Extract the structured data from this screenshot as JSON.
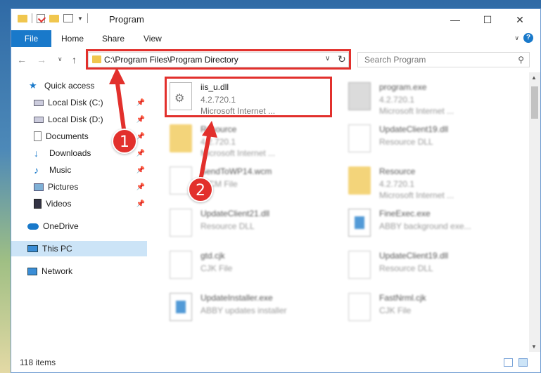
{
  "window": {
    "title": "Program"
  },
  "ribbon": {
    "tabs": [
      "File",
      "Home",
      "Share",
      "View"
    ],
    "help": "?"
  },
  "address": {
    "path": "C:\\Program Files\\Program Directory",
    "search_placeholder": "Search Program"
  },
  "sidebar": {
    "items": [
      {
        "label": "Quick access",
        "icon": "star-icon"
      },
      {
        "label": "Local Disk (C:)",
        "icon": "drive-icon",
        "pinned": true
      },
      {
        "label": "Local Disk (D:)",
        "icon": "drive-icon",
        "pinned": true
      },
      {
        "label": "Documents",
        "icon": "documents-icon",
        "pinned": true
      },
      {
        "label": "Downloads",
        "icon": "downloads-icon",
        "pinned": true
      },
      {
        "label": "Music",
        "icon": "music-icon",
        "pinned": true
      },
      {
        "label": "Pictures",
        "icon": "pictures-icon",
        "pinned": true
      },
      {
        "label": "Videos",
        "icon": "videos-icon",
        "pinned": true
      },
      {
        "label": "OneDrive",
        "icon": "cloud-icon"
      },
      {
        "label": "This PC",
        "icon": "computer-icon",
        "selected": true
      },
      {
        "label": "Network",
        "icon": "network-icon"
      }
    ]
  },
  "files": [
    {
      "name": "iis_u.dll",
      "line2": "4.2.720.1",
      "line3": "Microsoft Internet ...",
      "icon": "dll-icon"
    },
    {
      "name": "program.exe",
      "line2": "4.2.720.1",
      "line3": "Microsoft Internet ...",
      "icon": "exe-icon"
    },
    {
      "name": "Resource",
      "line2": "4.2.720.1",
      "line3": "Microsoft Internet ...",
      "icon": "folder-icon"
    },
    {
      "name": "UpdateClient19.dll",
      "line2": "Resource DLL",
      "line3": "",
      "icon": "dll-icon"
    },
    {
      "name": "SendToWP14.wcm",
      "line2": "WCM File",
      "line3": "",
      "icon": "file-icon"
    },
    {
      "name": "Resource",
      "line2": "4.2.720.1",
      "line3": "Microsoft Internet ...",
      "icon": "folder-icon"
    },
    {
      "name": "UpdateClient21.dll",
      "line2": "Resource DLL",
      "line3": "",
      "icon": "dll-icon"
    },
    {
      "name": "FineExec.exe",
      "line2": "ABBY background exe...",
      "line3": "",
      "icon": "exe-icon"
    },
    {
      "name": "gtd.cjk",
      "line2": "CJK File",
      "line3": "",
      "icon": "file-icon"
    },
    {
      "name": "UpdateClient19.dll",
      "line2": "Resource DLL",
      "line3": "",
      "icon": "dll-icon"
    },
    {
      "name": "UpdateInstaller.exe",
      "line2": "ABBY updates installer",
      "line3": "",
      "icon": "exe-icon"
    },
    {
      "name": "FastNrml.cjk",
      "line2": "CJK File",
      "line3": "",
      "icon": "file-icon"
    }
  ],
  "status": {
    "count": "118 items"
  },
  "annotations": {
    "badge1": "1",
    "badge2": "2"
  },
  "colors": {
    "accent": "#1979ca",
    "highlight": "#e2302c"
  }
}
